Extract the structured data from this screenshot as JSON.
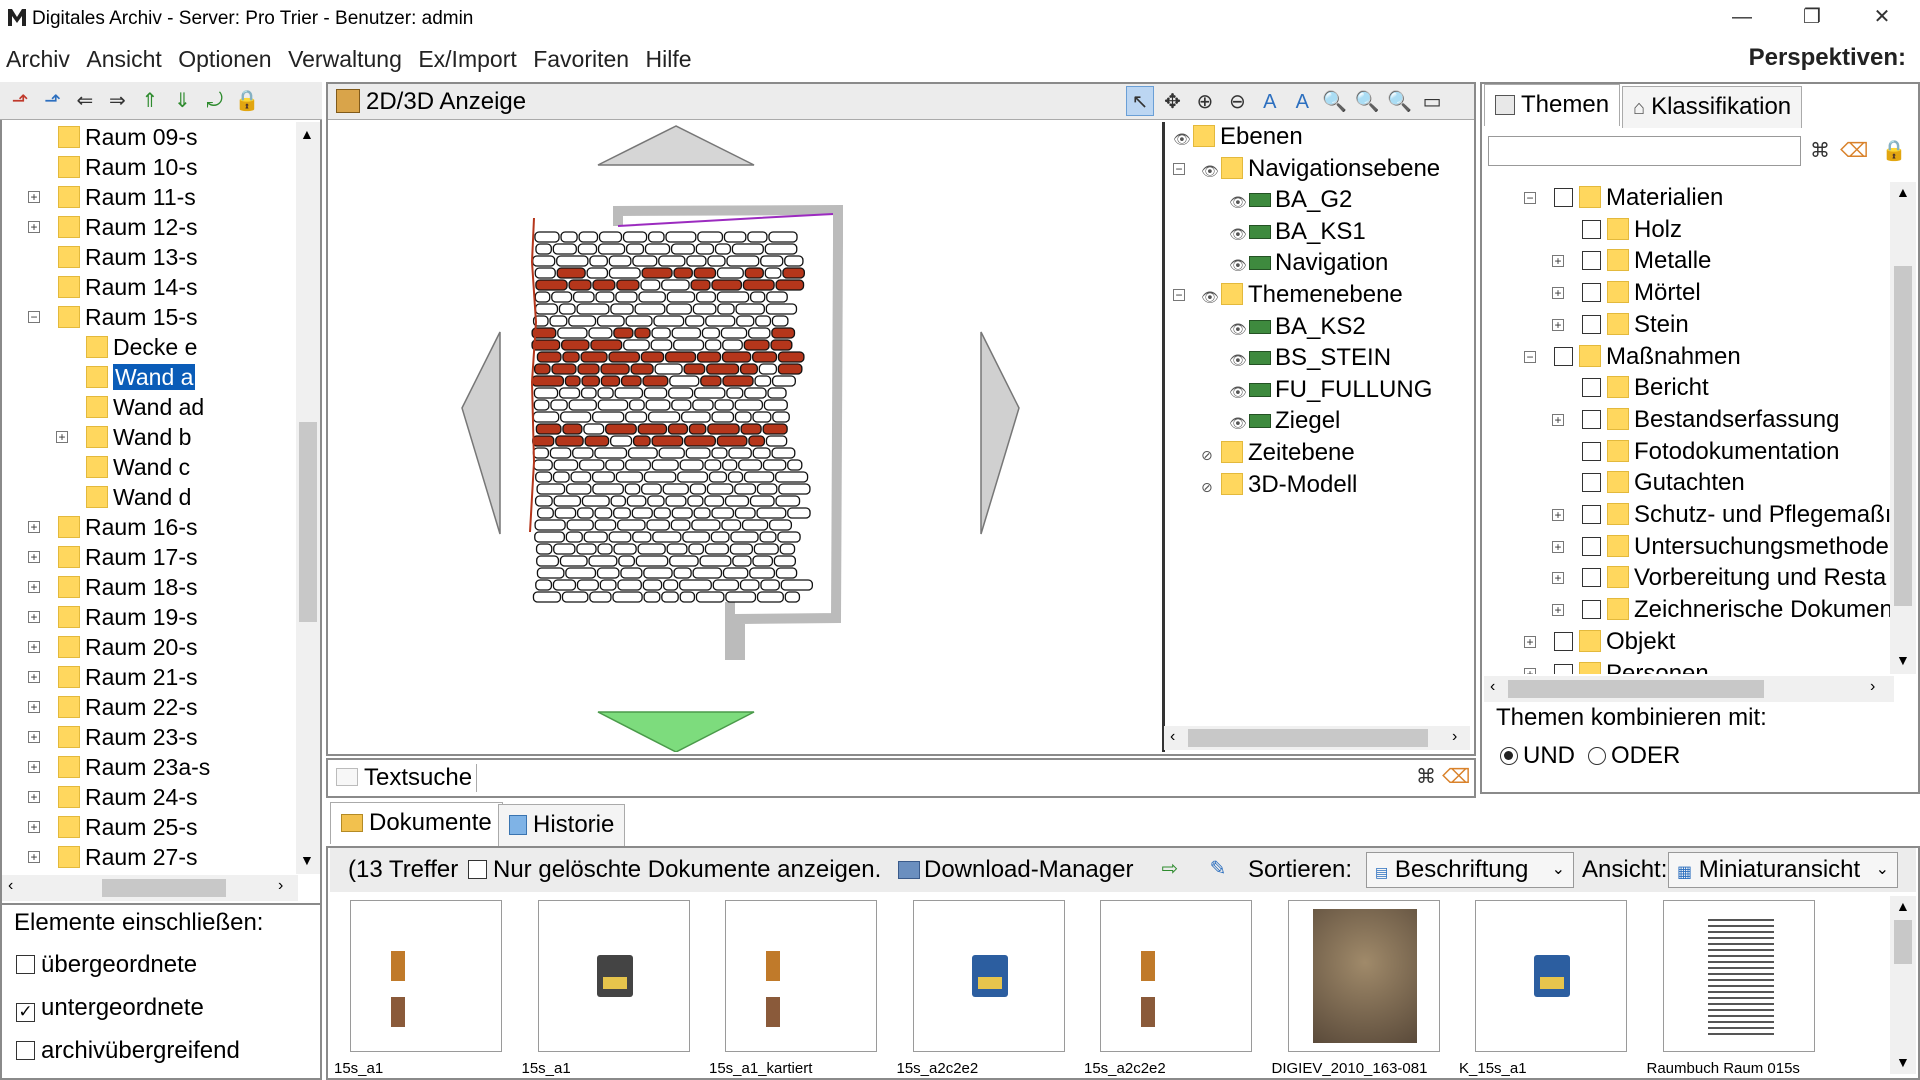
{
  "window": {
    "title": "Digitales Archiv - Server: Pro Trier - Benutzer: admin",
    "min_label": "—",
    "restore_label": "❐",
    "close_label": "✕"
  },
  "menu": [
    "Archiv",
    "Ansicht",
    "Optionen",
    "Verwaltung",
    "Ex/Import",
    "Favoriten",
    "Hilfe"
  ],
  "perspektiven": "Perspektiven:",
  "left_tree": {
    "items": [
      {
        "label": "Raum 09-s",
        "level": 1,
        "expander": ""
      },
      {
        "label": "Raum 10-s",
        "level": 1,
        "expander": ""
      },
      {
        "label": "Raum 11-s",
        "level": 1,
        "expander": "+"
      },
      {
        "label": "Raum 12-s",
        "level": 1,
        "expander": "+"
      },
      {
        "label": "Raum 13-s",
        "level": 1,
        "expander": ""
      },
      {
        "label": "Raum 14-s",
        "level": 1,
        "expander": ""
      },
      {
        "label": "Raum 15-s",
        "level": 1,
        "expander": "−"
      },
      {
        "label": "Decke e",
        "level": 2,
        "expander": ""
      },
      {
        "label": "Wand a",
        "level": 2,
        "expander": "",
        "selected": true
      },
      {
        "label": "Wand ad",
        "level": 2,
        "expander": ""
      },
      {
        "label": "Wand b",
        "level": 2,
        "expander": "+"
      },
      {
        "label": "Wand c",
        "level": 2,
        "expander": ""
      },
      {
        "label": "Wand d",
        "level": 2,
        "expander": ""
      },
      {
        "label": "Raum 16-s",
        "level": 1,
        "expander": "+"
      },
      {
        "label": "Raum 17-s",
        "level": 1,
        "expander": "+"
      },
      {
        "label": "Raum 18-s",
        "level": 1,
        "expander": "+"
      },
      {
        "label": "Raum 19-s",
        "level": 1,
        "expander": "+"
      },
      {
        "label": "Raum 20-s",
        "level": 1,
        "expander": "+"
      },
      {
        "label": "Raum 21-s",
        "level": 1,
        "expander": "+"
      },
      {
        "label": "Raum 22-s",
        "level": 1,
        "expander": "+"
      },
      {
        "label": "Raum 23-s",
        "level": 1,
        "expander": "+"
      },
      {
        "label": "Raum 23a-s",
        "level": 1,
        "expander": "+"
      },
      {
        "label": "Raum 24-s",
        "level": 1,
        "expander": "+"
      },
      {
        "label": "Raum 25-s",
        "level": 1,
        "expander": "+"
      },
      {
        "label": "Raum 27-s",
        "level": 1,
        "expander": "+"
      }
    ]
  },
  "include": {
    "title": "Elemente einschließen:",
    "options": [
      {
        "label": "übergeordnete",
        "checked": false
      },
      {
        "label": "untergeordnete",
        "checked": true
      },
      {
        "label": "archivübergreifend",
        "checked": false
      }
    ]
  },
  "viewer": {
    "title": "2D/3D Anzeige",
    "layers": [
      {
        "label": "Ebenen",
        "level": 0,
        "icon": "folder",
        "eye": "👁",
        "expander": ""
      },
      {
        "label": "Navigationsebene",
        "level": 1,
        "icon": "folder",
        "eye": "👁",
        "expander": "−"
      },
      {
        "label": "BA_G2",
        "level": 2,
        "icon": "layer",
        "eye": "👁",
        "expander": ""
      },
      {
        "label": "BA_KS1",
        "level": 2,
        "icon": "layer",
        "eye": "👁",
        "expander": ""
      },
      {
        "label": "Navigation",
        "level": 2,
        "icon": "layer",
        "eye": "👁",
        "expander": ""
      },
      {
        "label": "Themenebene",
        "level": 1,
        "icon": "folder",
        "eye": "👁",
        "expander": "−"
      },
      {
        "label": "BA_KS2",
        "level": 2,
        "icon": "layer",
        "eye": "👁",
        "expander": ""
      },
      {
        "label": "BS_STEIN",
        "level": 2,
        "icon": "layer",
        "eye": "👁",
        "expander": ""
      },
      {
        "label": "FU_FULLUNG",
        "level": 2,
        "icon": "layer",
        "eye": "👁",
        "expander": ""
      },
      {
        "label": "Ziegel",
        "level": 2,
        "icon": "layer",
        "eye": "👁",
        "expander": ""
      },
      {
        "label": "Zeitebene",
        "level": 1,
        "icon": "folder",
        "eye": "⊘",
        "expander": ""
      },
      {
        "label": "3D-Modell",
        "level": 1,
        "icon": "folder",
        "eye": "⊘",
        "expander": ""
      }
    ]
  },
  "textsearch": {
    "label": "Textsuche",
    "value": ""
  },
  "doc_tabs": [
    "Dokumente",
    "Historie"
  ],
  "docs_toolbar": {
    "count": "(13 Treffer",
    "deleted_label": "Nur gelöschte Dokumente anzeigen.",
    "download": "Download-Manager",
    "sort_label": "Sortieren:",
    "sort_value": "Beschriftung",
    "view_label": "Ansicht:",
    "view_value": "Miniaturansicht"
  },
  "documents": [
    {
      "caption": "15s_a1",
      "kind": "drawing"
    },
    {
      "caption": "15s_a1",
      "kind": "dxf"
    },
    {
      "caption": "15s_a1_kartiert",
      "kind": "drawing2"
    },
    {
      "caption": "15s_a2c2e2",
      "kind": "dwg"
    },
    {
      "caption": "15s_a2c2e2",
      "kind": "drawing3"
    },
    {
      "caption": "DIGIEV_2010_163-081",
      "kind": "photo"
    },
    {
      "caption": "K_15s_a1",
      "kind": "dwg"
    },
    {
      "caption": "Raumbuch Raum 015s",
      "kind": "text"
    }
  ],
  "right": {
    "tabs": [
      "Themen",
      "Klassifikation"
    ],
    "search_value": "",
    "tree": [
      {
        "label": "Materialien",
        "level": 1,
        "expander": "−"
      },
      {
        "label": "Holz",
        "level": 2,
        "expander": ""
      },
      {
        "label": "Metalle",
        "level": 2,
        "expander": "+"
      },
      {
        "label": "Mörtel",
        "level": 2,
        "expander": "+"
      },
      {
        "label": "Stein",
        "level": 2,
        "expander": "+"
      },
      {
        "label": "Maßnahmen",
        "level": 1,
        "expander": "−"
      },
      {
        "label": "Bericht",
        "level": 2,
        "expander": ""
      },
      {
        "label": "Bestandserfassung",
        "level": 2,
        "expander": "+"
      },
      {
        "label": "Fotodokumentation",
        "level": 2,
        "expander": ""
      },
      {
        "label": "Gutachten",
        "level": 2,
        "expander": ""
      },
      {
        "label": "Schutz- und Pflegemaßı",
        "level": 2,
        "expander": "+"
      },
      {
        "label": "Untersuchungsmethode",
        "level": 2,
        "expander": "+"
      },
      {
        "label": "Vorbereitung und Resta",
        "level": 2,
        "expander": "+"
      },
      {
        "label": "Zeichnerische Dokumen",
        "level": 2,
        "expander": "+"
      },
      {
        "label": "Objekt",
        "level": 1,
        "expander": "+"
      },
      {
        "label": "Personen",
        "level": 1,
        "expander": "+"
      }
    ],
    "combine_label": "Themen kombinieren mit:",
    "und": "UND",
    "oder": "ODER",
    "und_selected": true
  },
  "colors": {
    "selection": "#0a5cb8",
    "folder": "#ffd75e",
    "nav_arrow_down": "#7ddc7d",
    "nav_arrow": "#c8c8c8",
    "brick": "#b5361b"
  }
}
